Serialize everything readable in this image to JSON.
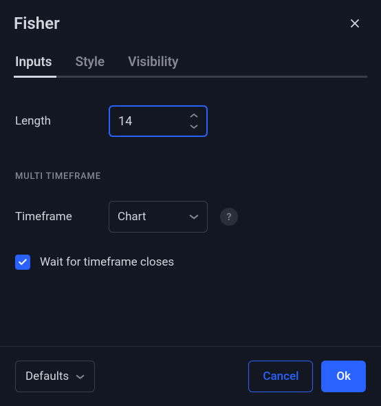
{
  "title": "Fisher",
  "tabs": [
    {
      "label": "Inputs",
      "active": true
    },
    {
      "label": "Style",
      "active": false
    },
    {
      "label": "Visibility",
      "active": false
    }
  ],
  "inputs": {
    "length_label": "Length",
    "length_value": "14"
  },
  "multi_timeframe": {
    "section_label": "MULTI TIMEFRAME",
    "timeframe_label": "Timeframe",
    "timeframe_value": "Chart",
    "wait_label": "Wait for timeframe closes",
    "wait_checked": true
  },
  "footer": {
    "defaults_label": "Defaults",
    "cancel_label": "Cancel",
    "ok_label": "Ok"
  }
}
